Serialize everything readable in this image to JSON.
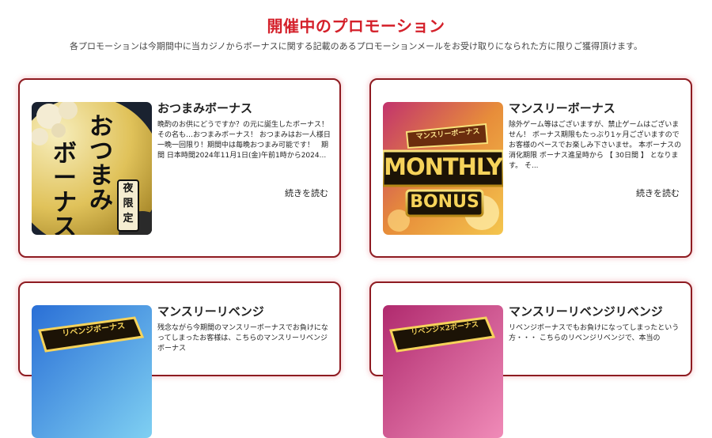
{
  "page": {
    "title": "開催中のプロモーション",
    "subtitle": "各プロモーションは今期間中に当カジノからボーナスに関する記載のあるプロモーションメールをお受け取りになられた方に限りご獲得頂けます。"
  },
  "promotions": [
    {
      "title": "おつまみボーナス",
      "description": "晩酌のお供にどうですか？の元に誕生したボーナス！ その名も…おつまみボーナス！ おつまみはお一人様日一晩一回限り！期間中は毎晩おつまみ可能です！　期間 日本時間2024年11月1日(金)午前1時から2024...",
      "read_more": "続きを読む",
      "image_text": [
        "お",
        "つ",
        "ま",
        "み",
        "ボ",
        "ー",
        "ナ",
        "ス"
      ],
      "image_badge": "夜限定"
    },
    {
      "title": "マンスリーボーナス",
      "description": "除外ゲーム等はございますが、禁止ゲームはございません！ ボーナス期限もたっぷり1ヶ月ございますのでお客様のペースでお楽しみ下さいませ。 本ボーナスの消化期限 ボーナス進呈時から 【 30日間 】 となります。 そ...",
      "read_more": "続きを読む",
      "image_banner": "マンスリーボーナス",
      "image_main": "MONTHLY",
      "image_sub": "BONUS"
    },
    {
      "title": "マンスリーリベンジ",
      "description": "残念ながら今期間のマンスリーボーナスでお負けになってしまったお客様は、こちらのマンスリーリベンジボーナス",
      "image_banner": "リベンジボーナス"
    },
    {
      "title": "マンスリーリベンジリベンジ",
      "description": "リベンジボーナスでもお負けになってしまったという方・・・ こちらのリベンジリベンジで、本当の",
      "image_banner": "リベンジ×2ボーナス"
    }
  ],
  "colors": {
    "accent_red": "#d4202a",
    "card_border": "#8e1b21"
  }
}
